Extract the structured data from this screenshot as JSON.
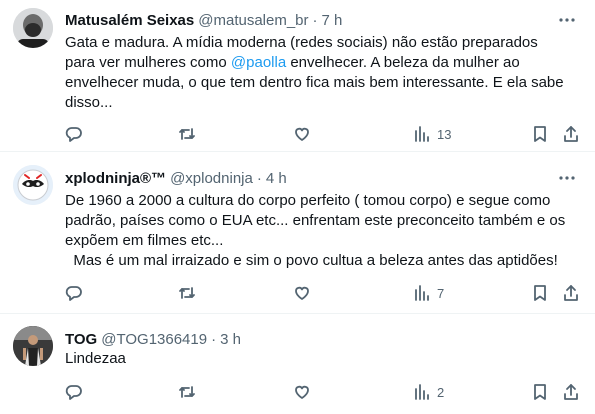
{
  "tweets": [
    {
      "name": "Matusalém Seixas",
      "handle": "@matusalem_br",
      "dot": "·",
      "time": "7 h",
      "lines": [
        "Gata e madura. A mídia moderna (redes sociais) não estão preparados",
        "envelhecer muda, o que tem dentro fica mais bem interessante. E ela sabe",
        "disso..."
      ],
      "line2_before": "para ver mulheres como ",
      "mention": "@paolla",
      "line2_after": " envelhecer.  A beleza da mulher ao",
      "views": "13",
      "avatar_icon": "avatar-bald-man"
    },
    {
      "name": "xplodninja®™",
      "handle": "@xplodninja",
      "dot": "·",
      "time": "4 h",
      "lines": [
        "De 1960 a 2000 a cultura do corpo perfeito ( tomou corpo) e segue como",
        "padrão, países como o EUA etc... enfrentam este preconceito também e os",
        "expõem em filmes etc...",
        "  Mas é um mal irraizado e sim o povo cultua a beleza antes das aptidões!"
      ],
      "views": "7",
      "avatar_icon": "avatar-ninja-mask"
    },
    {
      "name": "TOG",
      "handle": "@TOG1366419",
      "dot": "·",
      "time": "3 h",
      "lines": [
        "Lindezaa"
      ],
      "views": "2",
      "avatar_icon": "avatar-person-photo"
    }
  ],
  "icons": {
    "reply": "reply-icon",
    "retweet": "retweet-icon",
    "like": "like-icon",
    "views": "views-icon",
    "bookmark": "bookmark-icon",
    "share": "share-icon",
    "more": "more-icon"
  },
  "colors": {
    "text": "#0f1419",
    "secondary": "#536471",
    "mention": "#1d9bf0",
    "divider": "#eff3f4"
  }
}
